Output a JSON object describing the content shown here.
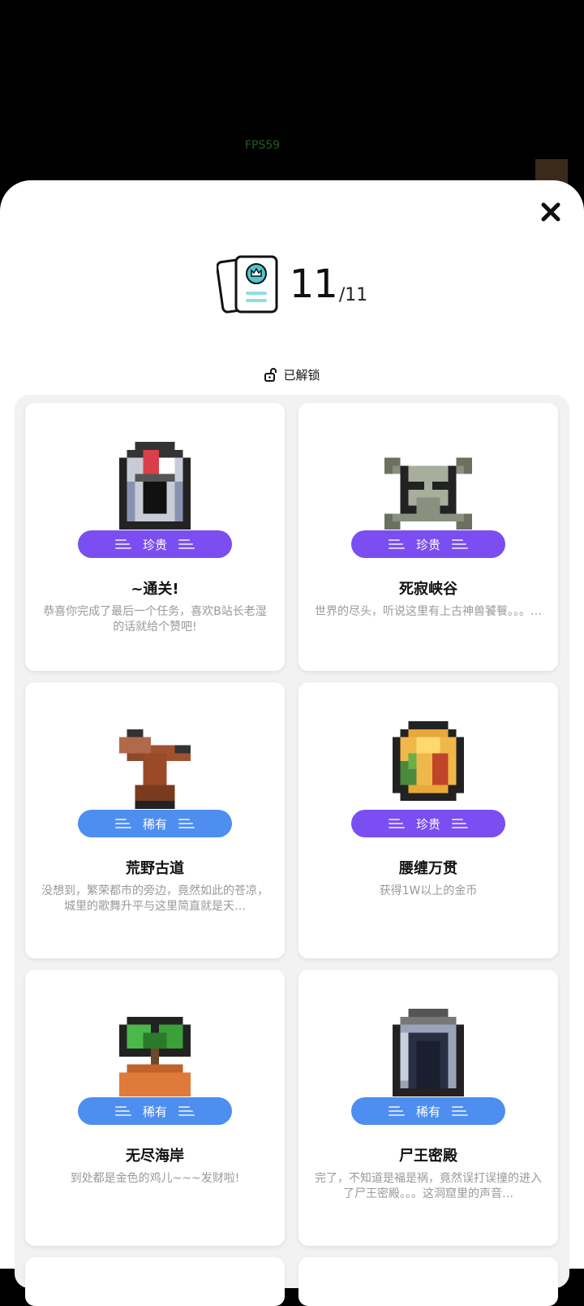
{
  "hud": {
    "fps": "FPS59"
  },
  "header": {
    "unlocked_count": "11",
    "total_count": "/11"
  },
  "tab": {
    "label": "已解锁"
  },
  "colors": {
    "precious": "#7a4ef0",
    "rare": "#4d8ef0"
  },
  "cards": [
    {
      "rarity": "珍贵",
      "rarity_type": "precious",
      "title": "~通关!",
      "desc": "恭喜你完成了最后一个任务，喜欢B站长老湿的话就给个赞吧!",
      "icon": "helmet-icon"
    },
    {
      "rarity": "珍贵",
      "rarity_type": "precious",
      "title": "死寂峡谷",
      "desc": "世界的尽头，听说这里有上古神兽饕餮。。。…",
      "icon": "skull-crossbones-icon"
    },
    {
      "rarity": "稀有",
      "rarity_type": "rare",
      "title": "荒野古道",
      "desc": "没想到，繁荣都市的旁边，竟然如此的苍凉，城里的歌舞升平与这里简直就是天…",
      "icon": "withered-tree-icon"
    },
    {
      "rarity": "珍贵",
      "rarity_type": "precious",
      "title": "腰缠万贯",
      "desc": "获得1W以上的金币",
      "icon": "gold-coin-icon"
    },
    {
      "rarity": "稀有",
      "rarity_type": "rare",
      "title": "无尽海岸",
      "desc": "到处都是金色的鸡儿~~~发财啦!",
      "icon": "palm-tree-icon"
    },
    {
      "rarity": "稀有",
      "rarity_type": "rare",
      "title": "尸王密殿",
      "desc": "完了，不知道是福是祸，竟然误打误撞的进入了尸王密殿。。。这洞窟里的声音…",
      "icon": "cave-icon"
    }
  ]
}
